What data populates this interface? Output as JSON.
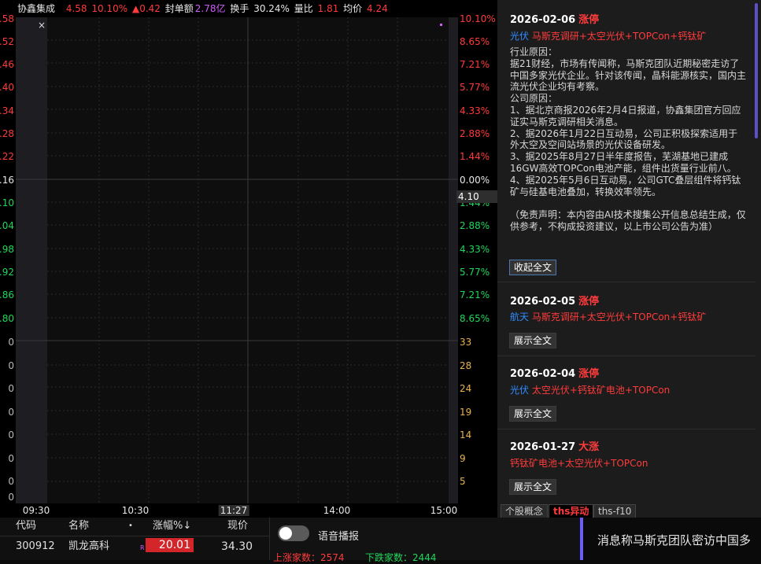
{
  "stock": {
    "name": "协鑫集成",
    "price": "4.58",
    "change_pct": "10.10%",
    "change": "▲0.42",
    "seal_label": "封单额",
    "seal_value": "2.78亿",
    "turnover_label": "换手",
    "turnover_value": "30.24%",
    "volume_ratio_label": "量比",
    "volume_ratio_value": "1.81",
    "avg_label": "均价",
    "avg_value": "4.24"
  },
  "chart": {
    "close_glyph": "×",
    "left_ticks": [
      ".58",
      ".52",
      ".46",
      ".40",
      ".34",
      ".28",
      ".22",
      ".16",
      ".10",
      ".04",
      ".98",
      ".92",
      ".86",
      ".80",
      "0",
      "0",
      "0",
      "0",
      "0",
      "0",
      "0",
      "0"
    ],
    "right_ticks": [
      "10.10%",
      "8.65%",
      "7.21%",
      "5.77%",
      "4.33%",
      "2.88%",
      "1.44%",
      "0.00%",
      "1.44%",
      "2.88%",
      "4.33%",
      "5.77%",
      "7.21%",
      "8.65%",
      "33",
      "28",
      "24",
      "19",
      "14",
      "9",
      "5"
    ],
    "time_ticks": [
      "09:30",
      "10:30",
      "11:27",
      "14:00",
      "15:00"
    ],
    "price_tag": "4.10"
  },
  "news": [
    {
      "date": "2026-02-06",
      "tag": "涨停",
      "sector": "光伏",
      "concepts": "马斯克调研+太空光伏+TOPCon+钙钛矿",
      "body": "行业原因：\n据21财经，市场有传闻称，马斯克团队近期秘密走访了中国多家光伏企业。针对该传闻，晶科能源核实，国内主流光伏企业均有考察。\n公司原因：\n1、据北京商报2026年2月4日报道，协鑫集团官方回应证实马斯克调研相关消息。\n2、据2026年1月22日互动易，公司正积极探索适用于外太空及空间站场景的光伏设备研发。\n3、据2025年8月27日半年度报告，芜湖基地已建成16GW高效TOPCon电池产能，组件出货量行业前八。\n4、据2025年5月6日互动易，公司GTC叠层组件将钙钛矿与硅基电池叠加，转换效率领先。\n\n（免责声明：本内容由AI技术搜集公开信息总结生成，仅供参考，不构成投资建议，以上市公司公告为准）",
      "button": "收起全文"
    },
    {
      "date": "2026-02-05",
      "tag": "涨停",
      "sector": "航天",
      "concepts": "马斯克调研+太空光伏+TOPCon+钙钛矿",
      "button": "展示全文"
    },
    {
      "date": "2026-02-04",
      "tag": "涨停",
      "sector": "光伏",
      "concepts": "太空光伏+钙钛矿电池+TOPCon",
      "button": "展示全文"
    },
    {
      "date": "2026-01-27",
      "tag": "大涨",
      "sector": "",
      "concepts": "钙钛矿电池+太空光伏+TOPCon",
      "button": "展示全文"
    }
  ],
  "tabs": [
    "个股概念",
    "ths异动",
    "ths-f10"
  ],
  "table": {
    "headers": [
      "代码",
      "名称",
      "•",
      "涨幅%↓",
      "现价"
    ],
    "row": {
      "code": "300912",
      "name": "凯龙高科",
      "marker": "R",
      "change": "20.01",
      "price": "34.30"
    }
  },
  "voice": {
    "label": "语音播报"
  },
  "market": {
    "up_label": "上涨家数：",
    "up_value": "2574",
    "down_label": "下跌家数：",
    "down_value": "2444"
  },
  "ticker": {
    "text": "消息称马斯克团队密访中国多"
  },
  "colors": {
    "up": "#ff3b3b",
    "down": "#1fd75b",
    "accent": "#6b5cff",
    "link": "#2f8cff"
  }
}
